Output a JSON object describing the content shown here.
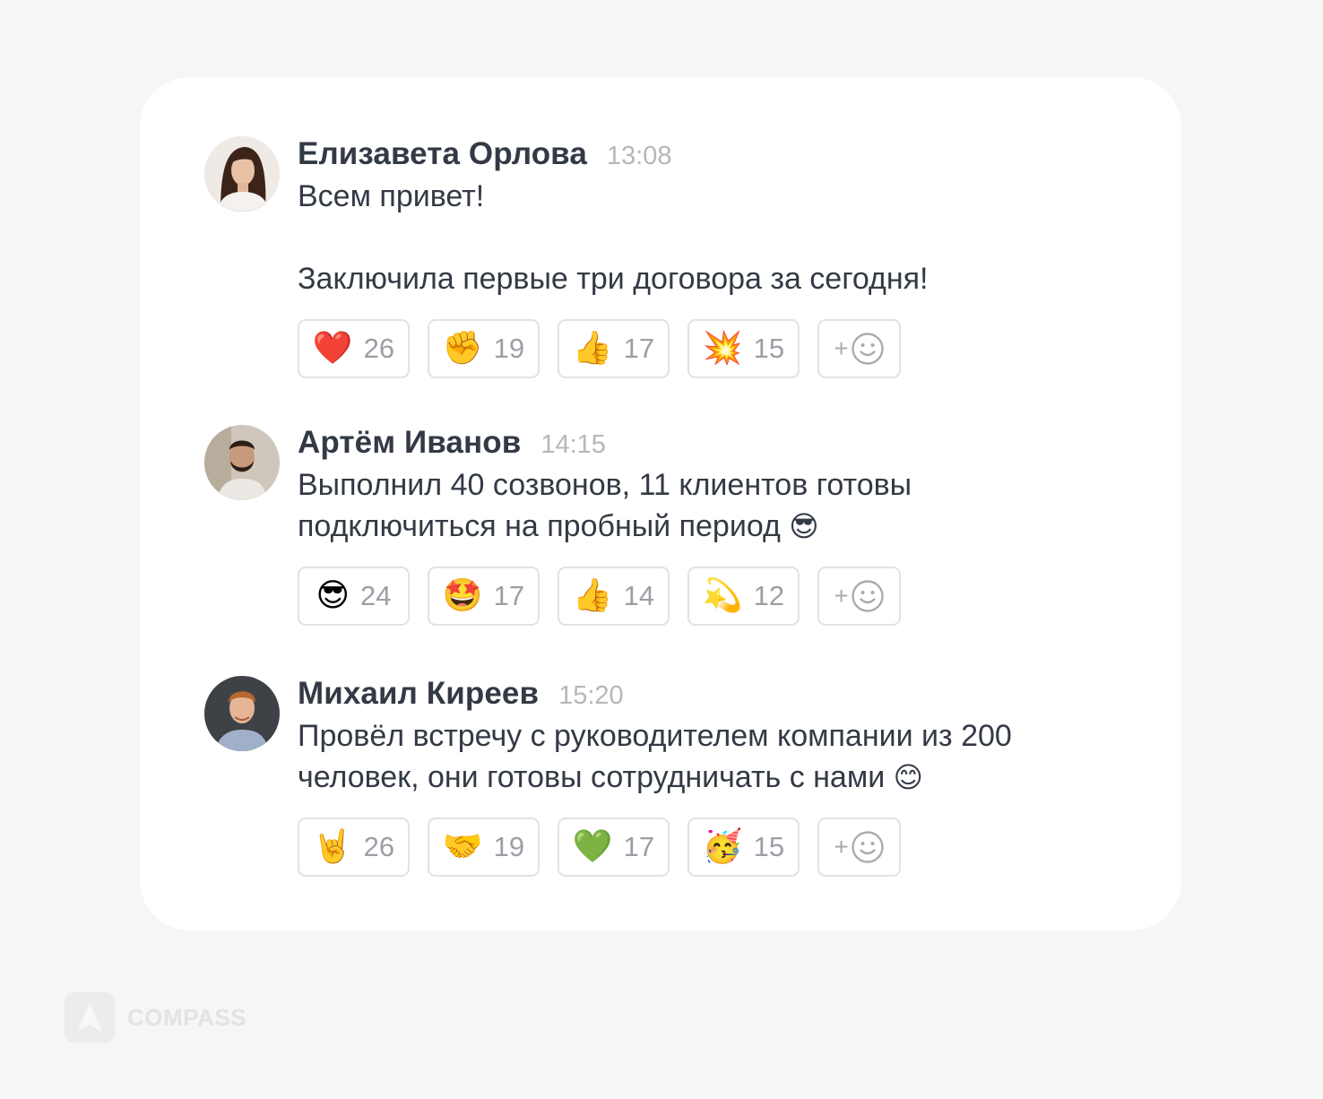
{
  "messages": [
    {
      "author": "Елизавета Орлова",
      "time": "13:08",
      "avatar": "avatar-woman-long-hair",
      "paragraphs": [
        "Всем привет!",
        "Заключила первые три договора за сегодня!"
      ],
      "trailing_emoji": "",
      "reactions": [
        {
          "emoji": "❤️",
          "icon": "red-heart-icon",
          "count": "26"
        },
        {
          "emoji": "✊",
          "icon": "raised-fist-icon",
          "count": "19"
        },
        {
          "emoji": "👍",
          "icon": "thumbs-up-icon",
          "count": "17"
        },
        {
          "emoji": "💥",
          "icon": "collision-icon",
          "count": "15"
        }
      ],
      "add_reaction_label": "+"
    },
    {
      "author": "Артём Иванов",
      "time": "14:15",
      "avatar": "avatar-man-beard",
      "paragraphs": [
        "Выполнил 40 созвонов, 11 клиентов готовы подключиться на пробный период"
      ],
      "trailing_emoji": "😎",
      "reactions": [
        {
          "emoji": "😎",
          "icon": "sunglasses-face-icon",
          "count": "24"
        },
        {
          "emoji": "🤩",
          "icon": "star-struck-icon",
          "count": "17"
        },
        {
          "emoji": "👍",
          "icon": "thumbs-up-icon",
          "count": "14"
        },
        {
          "emoji": "💫",
          "icon": "dizzy-icon",
          "count": "12"
        }
      ],
      "add_reaction_label": "+"
    },
    {
      "author": "Михаил Киреев",
      "time": "15:20",
      "avatar": "avatar-man-ginger",
      "paragraphs": [
        "Провёл встречу с руководителем компании из 200 человек, они готовы сотрудничать с нами"
      ],
      "trailing_emoji": "😊",
      "reactions": [
        {
          "emoji": "🤘",
          "icon": "sign-of-horns-icon",
          "count": "26"
        },
        {
          "emoji": "🤝",
          "icon": "handshake-icon",
          "count": "19"
        },
        {
          "emoji": "💚",
          "icon": "green-heart-icon",
          "count": "17"
        },
        {
          "emoji": "🥳",
          "icon": "partying-face-icon",
          "count": "15"
        }
      ],
      "add_reaction_label": "+"
    }
  ],
  "brand": {
    "name": "COMPASS"
  }
}
